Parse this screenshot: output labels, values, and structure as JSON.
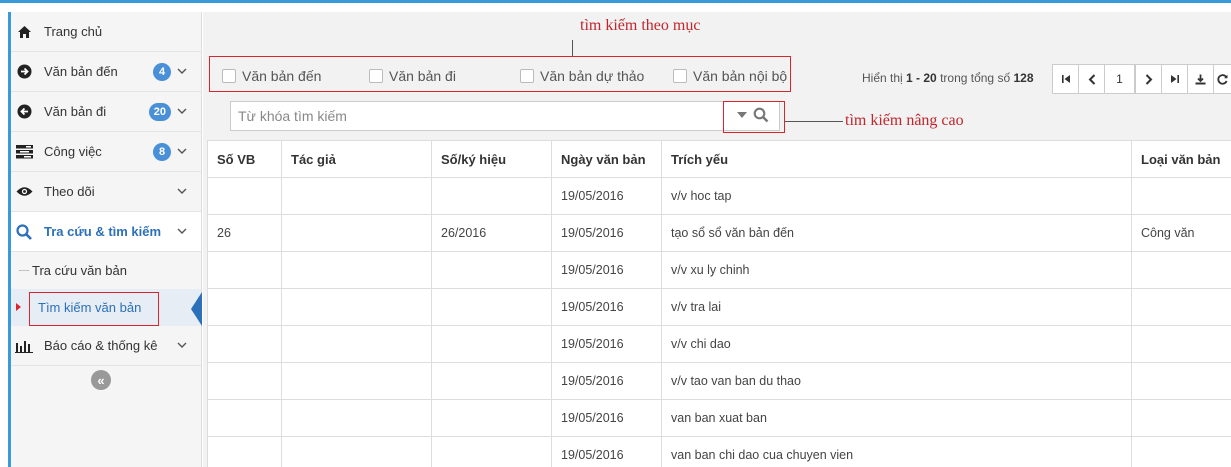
{
  "sidebar": {
    "items": [
      {
        "label": "Trang chủ",
        "icon": "home-icon"
      },
      {
        "label": "Văn bản đến",
        "icon": "arrow-circle-right-icon",
        "badge": "4"
      },
      {
        "label": "Văn bản đi",
        "icon": "arrow-circle-left-icon",
        "badge": "20"
      },
      {
        "label": "Công việc",
        "icon": "tasks-icon",
        "badge": "8"
      },
      {
        "label": "Theo dõi",
        "icon": "eye-icon"
      },
      {
        "label": "Tra cứu & tìm kiếm",
        "icon": "search-icon"
      },
      {
        "label": "Báo cáo & thống kê",
        "icon": "bar-chart-icon"
      }
    ],
    "sub_items": [
      {
        "label": "Tra cứu văn bản"
      },
      {
        "label": "Tìm kiếm văn bản"
      }
    ],
    "collapse_label": "«"
  },
  "annotations": {
    "category_search": "tìm kiếm theo mục",
    "advanced_search": "tìm kiếm nâng cao"
  },
  "filters": [
    {
      "label": "Văn bản đến"
    },
    {
      "label": "Văn bản đi"
    },
    {
      "label": "Văn bản dự thảo"
    },
    {
      "label": "Văn bản nội bộ"
    }
  ],
  "pager": {
    "prefix": "Hiển thị",
    "range": "1 - 20",
    "middle": "trong tổng số",
    "total": "128",
    "current_page": "1"
  },
  "search": {
    "placeholder": "Từ khóa tìm kiếm"
  },
  "table": {
    "columns": [
      "Số VB",
      "Tác giả",
      "Số/ký hiệu",
      "Ngày văn bản",
      "Trích yếu",
      "Loại văn bản"
    ],
    "rows": [
      [
        "",
        "",
        "",
        "19/05/2016",
        "v/v hoc tap",
        ""
      ],
      [
        "26",
        "",
        "26/2016",
        "19/05/2016",
        "tạo sổ sổ văn bản đến",
        "Công văn"
      ],
      [
        "",
        "",
        "",
        "19/05/2016",
        "v/v xu ly chinh",
        ""
      ],
      [
        "",
        "",
        "",
        "19/05/2016",
        "v/v tra lai",
        ""
      ],
      [
        "",
        "",
        "",
        "19/05/2016",
        "v/v chi dao",
        ""
      ],
      [
        "",
        "",
        "",
        "19/05/2016",
        "v/v tao van ban du thao",
        ""
      ],
      [
        "",
        "",
        "",
        "19/05/2016",
        "van ban xuat ban",
        ""
      ],
      [
        "",
        "",
        "",
        "19/05/2016",
        "van ban chi dao cua chuyen vien",
        ""
      ]
    ]
  },
  "colors": {
    "accent": "#3a9ad9",
    "annotation_red": "#c0262c",
    "badge_blue": "#4a90d9",
    "active_link": "#2b70b8"
  }
}
